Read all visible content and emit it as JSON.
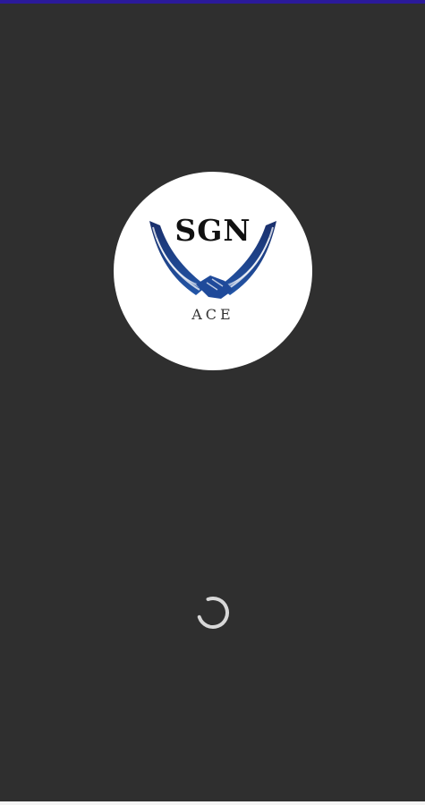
{
  "splash": {
    "logo": {
      "brand_main": "SGN",
      "brand_sub": "ACE",
      "icon": "winged-handshake-icon",
      "wing_color": "#1c3f86",
      "background_color": "#ffffff"
    },
    "loading": {
      "icon": "loading-spinner-icon"
    }
  },
  "colors": {
    "background": "#2f2f2f",
    "status_strip": "#2b1a9a"
  }
}
